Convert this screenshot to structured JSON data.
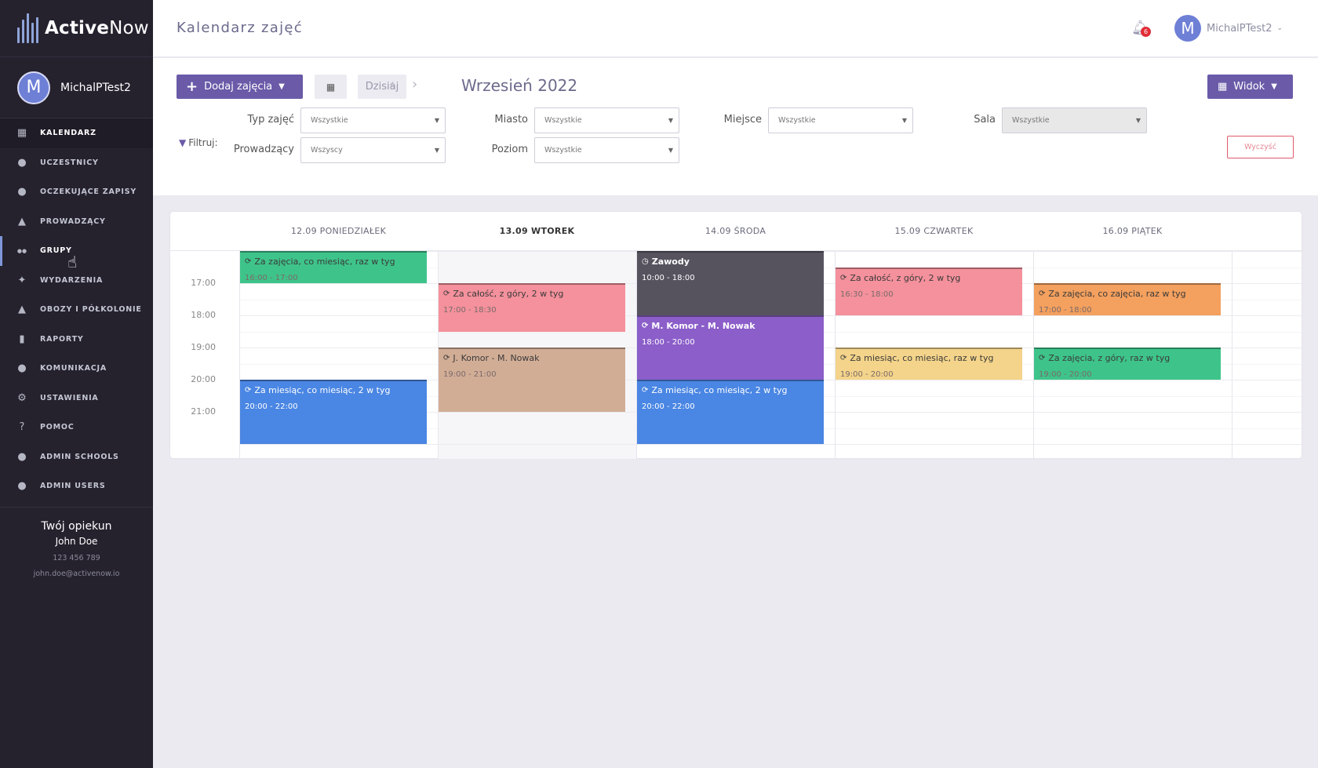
{
  "brand": {
    "bold": "Active",
    "light": "Now"
  },
  "sidebar": {
    "user_initial": "M",
    "user_name": "MichalPTest2",
    "items": [
      {
        "label": "KALENDARZ",
        "icon": "calendar-icon"
      },
      {
        "label": "UCZESTNICY",
        "icon": "user-icon"
      },
      {
        "label": "OCZEKUJĄCE ZAPISY",
        "icon": "user-clock-icon"
      },
      {
        "label": "PROWADZĄCY",
        "icon": "graduation-cap-icon"
      },
      {
        "label": "GRUPY",
        "icon": "users-icon"
      },
      {
        "label": "WYDARZENIA",
        "icon": "party-icon"
      },
      {
        "label": "OBOZY I PÓŁKOLONIE",
        "icon": "tent-icon"
      },
      {
        "label": "RAPORTY",
        "icon": "chart-icon"
      },
      {
        "label": "KOMUNIKACJA",
        "icon": "chat-icon"
      },
      {
        "label": "USTAWIENIA",
        "icon": "gear-icon"
      },
      {
        "label": "POMOC",
        "icon": "help-icon"
      },
      {
        "label": "ADMIN SCHOOLS",
        "icon": "user-icon"
      },
      {
        "label": "ADMIN USERS",
        "icon": "user-icon"
      }
    ],
    "caretaker": {
      "title": "Twój opiekun",
      "name": "John Doe",
      "phone": "123 456 789",
      "email": "john.doe@activenow.io"
    }
  },
  "header": {
    "title": "Kalendarz zajęć",
    "notifications": "6",
    "user_initial": "M",
    "user_name": "MichalPTest2"
  },
  "toolbar": {
    "add_label": "Dodaj zajęcia",
    "today_label": "Dzisiaj",
    "month": "Wrzesień 2022",
    "view_label": "Widok"
  },
  "filters": {
    "label": "Filtruj:",
    "type_label": "Typ zajęć",
    "type_value": "Wszystkie",
    "city_label": "Miasto",
    "city_value": "Wszystkie",
    "place_label": "Miejsce",
    "place_value": "Wszystkie",
    "room_label": "Sala",
    "room_value": "Wszystkie",
    "teacher_label": "Prowadzący",
    "teacher_value": "Wszyscy",
    "level_label": "Poziom",
    "level_value": "Wszystkie",
    "clear_label": "Wyczyść"
  },
  "calendar": {
    "days": [
      {
        "label": "12.09 PONIEDZIAŁEK",
        "today": false
      },
      {
        "label": "13.09 WTOREK",
        "today": true
      },
      {
        "label": "14.09 ŚRODA",
        "today": false
      },
      {
        "label": "15.09 CZWARTEK",
        "today": false
      },
      {
        "label": "16.09 PIĄTEK",
        "today": false
      }
    ],
    "times": [
      "17:00",
      "18:00",
      "19:00",
      "20:00",
      "21:00"
    ],
    "events": [
      {
        "day": 0,
        "title": "Za zajęcia, co miesiąc, raz w tyg",
        "time": "16:00 - 17:00",
        "color": "#3ec48a",
        "style": "light",
        "icon": "repeat-icon"
      },
      {
        "day": 0,
        "title": "Za miesiąc, co miesiąc, 2 w tyg",
        "time": "20:00 - 22:00",
        "color": "#4a86e3",
        "style": "blue",
        "icon": "repeat-icon"
      },
      {
        "day": 1,
        "title": "Za całość, z góry, 2 w tyg",
        "time": "17:00 - 18:30",
        "color": "#f4919c",
        "style": "light",
        "icon": "repeat-icon"
      },
      {
        "day": 1,
        "title": "J. Komor - M. Nowak",
        "time": "19:00 - 21:00",
        "color": "#d2ad96",
        "style": "light",
        "icon": "repeat-icon"
      },
      {
        "day": 2,
        "title": "Zawody",
        "time": "10:00 - 18:00",
        "color": "#56535f",
        "style": "dark",
        "icon": "clock-icon"
      },
      {
        "day": 2,
        "title": "M. Komor - M. Nowak",
        "time": "18:00 - 20:00",
        "color": "#8b5ec9",
        "style": "dark",
        "icon": "repeat-icon"
      },
      {
        "day": 2,
        "title": "Za miesiąc, co miesiąc, 2 w tyg",
        "time": "20:00 - 22:00",
        "color": "#4a86e3",
        "style": "blue",
        "icon": "repeat-icon"
      },
      {
        "day": 3,
        "title": "Za całość, z góry, 2 w tyg",
        "time": "16:30 - 18:00",
        "color": "#f4919c",
        "style": "light",
        "icon": "repeat-icon"
      },
      {
        "day": 3,
        "title": "Za miesiąc, co miesiąc, raz w tyg",
        "time": "19:00 - 20:00",
        "color": "#f4d48a",
        "style": "light",
        "icon": "repeat-icon"
      },
      {
        "day": 4,
        "title": "Za zajęcia, co zajęcia, raz w tyg",
        "time": "17:00 - 18:00",
        "color": "#f4a05e",
        "style": "light",
        "icon": "repeat-icon"
      },
      {
        "day": 4,
        "title": "Za zajęcia, z góry, raz w tyg",
        "time": "19:00 - 20:00",
        "color": "#3ec48a",
        "style": "light",
        "icon": "repeat-icon"
      }
    ]
  }
}
